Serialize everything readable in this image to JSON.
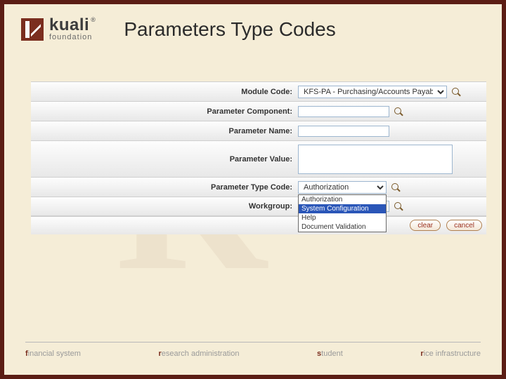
{
  "brand": {
    "name": "kuali",
    "sub": "foundation"
  },
  "title": "Parameters Type Codes",
  "form": {
    "module_code": {
      "label": "Module Code:",
      "value": "KFS-PA - Purchasing/Accounts Payable"
    },
    "parameter_component": {
      "label": "Parameter Component:",
      "value": ""
    },
    "parameter_name": {
      "label": "Parameter Name:",
      "value": ""
    },
    "parameter_value": {
      "label": "Parameter Value:",
      "value": ""
    },
    "parameter_type_code": {
      "label": "Parameter Type Code:",
      "selected": "Authorization",
      "options": [
        "Authorization",
        "System Configuration",
        "Help",
        "Document Validation"
      ],
      "highlighted_index": 1
    },
    "workgroup": {
      "label": "Workgroup:",
      "value": ""
    }
  },
  "buttons": {
    "clear": "clear",
    "cancel": "cancel"
  },
  "footer": {
    "items": [
      {
        "accent": "f",
        "rest": "inancial system"
      },
      {
        "accent": "r",
        "rest": "esearch administration"
      },
      {
        "accent": "s",
        "rest": "tudent"
      },
      {
        "accent": "r",
        "rest": "ice infrastructure"
      }
    ]
  }
}
